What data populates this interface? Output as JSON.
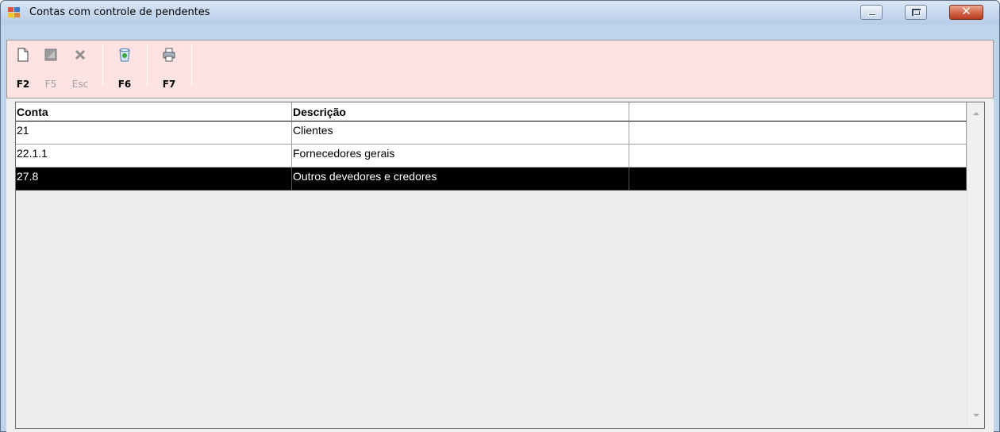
{
  "window": {
    "title": "Contas com controle de pendentes"
  },
  "toolbar": {
    "items": [
      {
        "key": "F2",
        "icon": "new-document-icon",
        "enabled": true
      },
      {
        "key": "F5",
        "icon": "save-icon",
        "enabled": false
      },
      {
        "key": "Esc",
        "icon": "cancel-x-icon",
        "enabled": false
      },
      {
        "key": "F6",
        "icon": "recycle-bin-icon",
        "enabled": true
      },
      {
        "key": "F7",
        "icon": "printer-icon",
        "enabled": true
      }
    ]
  },
  "grid": {
    "columns": [
      "Conta",
      "Descrição",
      ""
    ],
    "rows": [
      {
        "conta": "21",
        "descricao": "Clientes",
        "extra": ""
      },
      {
        "conta": "22.1.1",
        "descricao": "Fornecedores gerais",
        "extra": ""
      },
      {
        "conta": "27.8",
        "descricao": "Outros devedores e credores",
        "extra": "",
        "selected": true
      }
    ]
  },
  "colors": {
    "toolbar_bg": "#ffe3e3",
    "selected_row_bg": "#000000",
    "selected_row_fg": "#ffffff",
    "close_button": "#c7482a"
  }
}
